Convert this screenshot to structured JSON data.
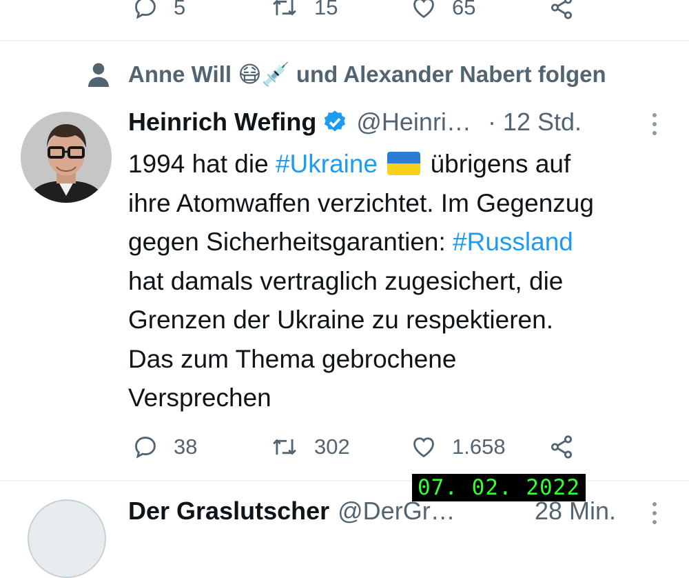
{
  "previous_tweet": {
    "actions": {
      "reply_count": "5",
      "retweet_count": "15",
      "like_count": "65"
    }
  },
  "tweet": {
    "social_context": "Anne Will 😷💉 und Alexander Nabert folgen",
    "author_name": "Heinrich Wefing",
    "handle": "@Heinri…",
    "time": "· 12 Std.",
    "text": {
      "l1_a": "1994 hat die ",
      "l1_tag": "#Ukraine",
      "l1_b": " übrigens auf",
      "l2": "ihre Atomwaffen verzichtet. Im Gegenzug",
      "l3_a": "gegen Sicherheitsgarantien: ",
      "l3_tag": "#Russland",
      "l4": "hat damals vertraglich zugesichert, die",
      "l5": "Grenzen der Ukraine zu respektieren.",
      "l6": "Das zum Thema gebrochene",
      "l7": "Versprechen"
    },
    "actions": {
      "reply_count": "38",
      "retweet_count": "302",
      "like_count": "1.658"
    }
  },
  "next_tweet": {
    "author_name": "Der Graslutscher",
    "handle": "@DerGr…",
    "time": "28 Min."
  },
  "date_stamp": "07. 02. 2022",
  "colors": {
    "hashtag": "#1d9bf0",
    "secondary_text": "#536471",
    "verified": "#1d9bf0",
    "stamp_text": "#33ff33"
  },
  "icons": [
    "reply-icon",
    "retweet-icon",
    "like-icon",
    "share-icon",
    "person-icon",
    "verified-badge-icon",
    "more-options-icon",
    "ukraine-flag-emoji",
    "mask-emoji",
    "syringe-emoji"
  ]
}
